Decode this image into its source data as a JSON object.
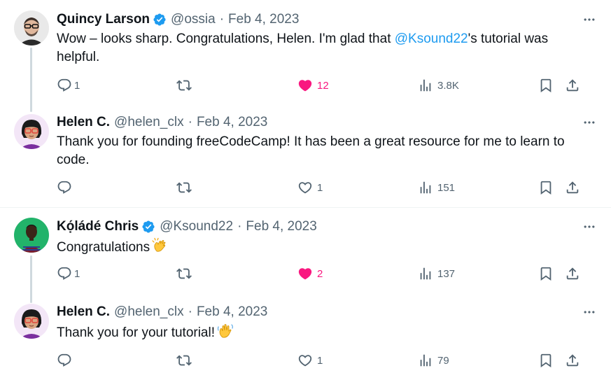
{
  "colors": {
    "link": "#1d9bf0",
    "muted": "#536471",
    "like": "#f91880",
    "verified": "#1d9bf0"
  },
  "tweets": [
    {
      "name": "Quincy Larson",
      "verified": true,
      "handle": "@ossia",
      "separator": "·",
      "date": "Feb 4, 2023",
      "text_before": "Wow – looks sharp. Congratulations, Helen. I'm glad that ",
      "mention": "@Ksound22",
      "text_after": "'s tutorial was helpful.",
      "replies": "1",
      "retweets": "",
      "likes": "12",
      "liked": true,
      "views": "3.8K"
    },
    {
      "name": "Helen C.",
      "verified": false,
      "handle": "@helen_clx",
      "separator": "·",
      "date": "Feb 4, 2023",
      "text": "Thank you for founding freeCodeCamp! It has been a great resource for me to learn to code.",
      "replies": "",
      "retweets": "",
      "likes": "1",
      "liked": false,
      "views": "151"
    },
    {
      "name": "Kọ́ládé Chris",
      "verified": true,
      "handle": "@Ksound22",
      "separator": "·",
      "date": "Feb 4, 2023",
      "text": "Congratulations",
      "emoji": "clapping-hands-emoji",
      "replies": "1",
      "retweets": "",
      "likes": "2",
      "liked": true,
      "views": "137"
    },
    {
      "name": "Helen C.",
      "verified": false,
      "handle": "@helen_clx",
      "separator": "·",
      "date": "Feb 4, 2023",
      "text": "Thank you for your tutorial!",
      "emoji": "waving-hand-emoji",
      "replies": "",
      "retweets": "",
      "likes": "1",
      "liked": false,
      "views": "79"
    }
  ]
}
